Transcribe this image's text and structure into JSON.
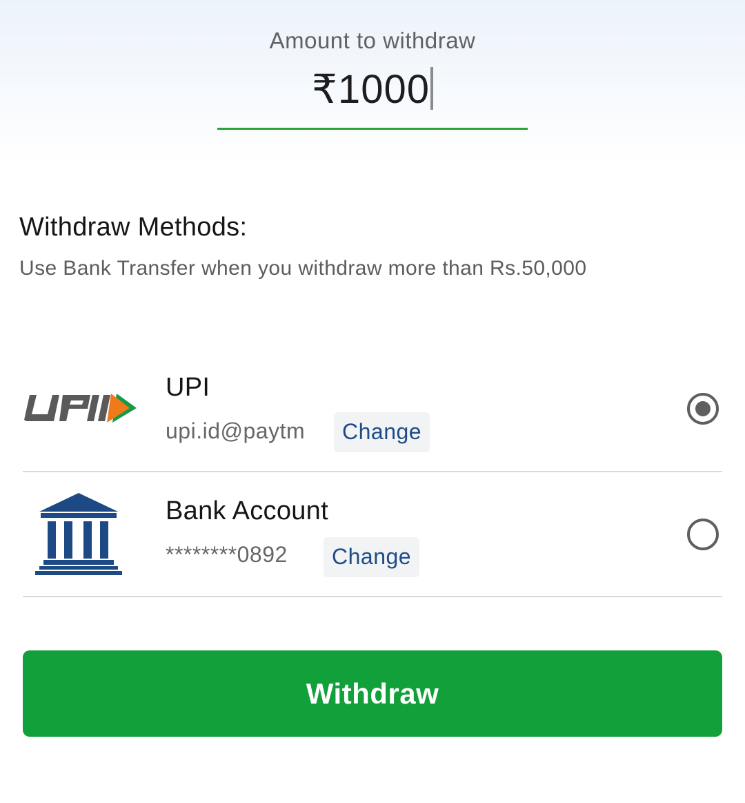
{
  "amount": {
    "label": "Amount to withdraw",
    "value": "₹1000"
  },
  "methods_section": {
    "title": "Withdraw Methods:",
    "subtitle": "Use Bank Transfer when you withdraw more than Rs.50,000"
  },
  "methods": [
    {
      "title": "UPI",
      "detail": "upi.id@paytm",
      "change_label": "Change",
      "selected": true,
      "icon": "upi-logo"
    },
    {
      "title": "Bank Account",
      "detail": "********0892",
      "change_label": "Change",
      "selected": false,
      "icon": "bank-icon"
    }
  ],
  "withdraw_button": {
    "label": "Withdraw"
  },
  "colors": {
    "accent_green": "#12a03a",
    "link_blue": "#1f4c86",
    "bank_blue": "#1d4a84",
    "upi_orange": "#f07a1a",
    "upi_green": "#169a47"
  }
}
